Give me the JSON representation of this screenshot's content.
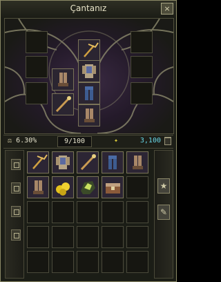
{
  "window": {
    "title": "Çantanız",
    "close_label": "×"
  },
  "equipment": {
    "slots": [
      {
        "name": "slot-earring-left",
        "item": null
      },
      {
        "name": "slot-head",
        "item": "pickaxe"
      },
      {
        "name": "slot-earring-right",
        "item": null
      },
      {
        "name": "slot-necklace",
        "item": null
      },
      {
        "name": "slot-chest",
        "item": "armor"
      },
      {
        "name": "slot-boots-top",
        "item": null
      },
      {
        "name": "slot-ring-left",
        "item": null
      },
      {
        "name": "slot-gloves",
        "item": "boots"
      },
      {
        "name": "slot-belt",
        "item": "pants"
      },
      {
        "name": "slot-ring-right",
        "item": null
      },
      {
        "name": "slot-weapon",
        "item": "staff"
      },
      {
        "name": "slot-legs",
        "item": "boots"
      }
    ]
  },
  "stats": {
    "weight_percent": "6.30%",
    "item_count": "9/100",
    "gold": "3,100"
  },
  "inventory": {
    "rows": [
      [
        "pickaxe",
        "armor",
        "staff",
        "pants",
        "boots"
      ],
      [
        "boots",
        "gold",
        "ore",
        "chest",
        null
      ],
      [
        null,
        null,
        null,
        null,
        null
      ],
      [
        null,
        null,
        null,
        null,
        null
      ],
      [
        null,
        null,
        null,
        null,
        null
      ]
    ]
  },
  "side_buttons": {
    "star_label": "★",
    "sort_label": "✎"
  },
  "colors": {
    "accent_gold": "#68d8e8",
    "border": "#8c8a66",
    "item_bg": "#2c2534"
  }
}
